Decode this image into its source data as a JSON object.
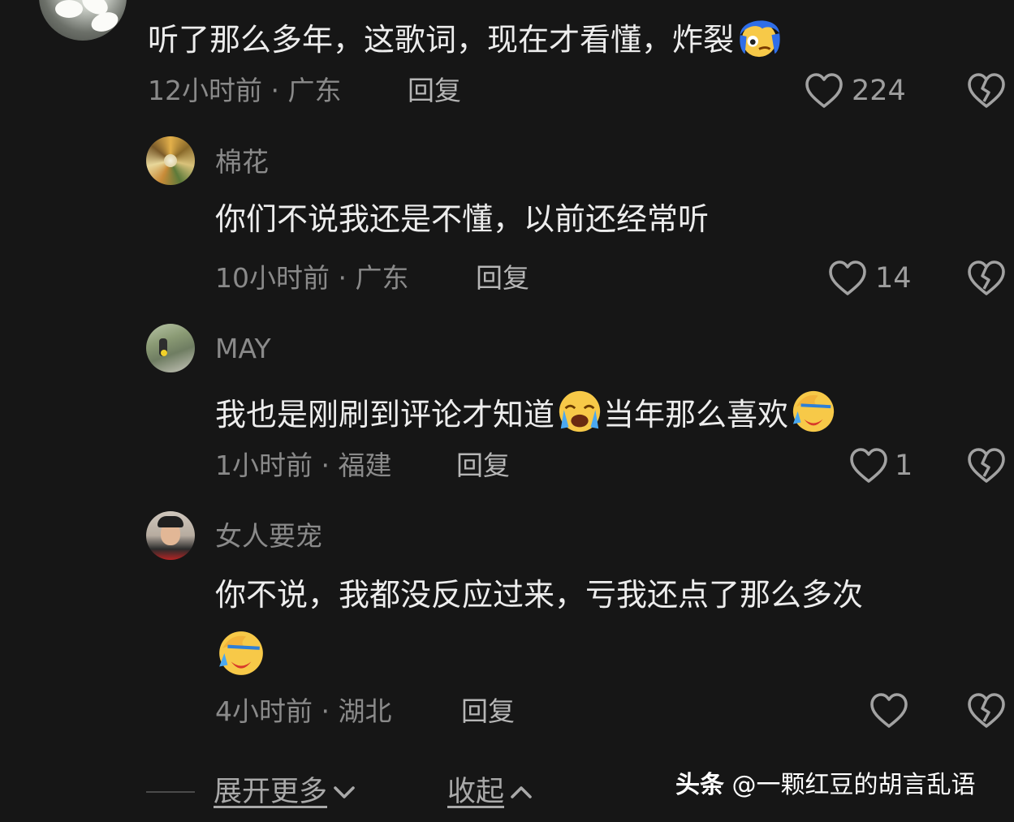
{
  "icons": {
    "like": "heart-outline-icon",
    "dislike": "broken-heart-icon",
    "expand": "chevron-down-icon",
    "collapse": "chevron-up-icon"
  },
  "colors": {
    "background": "#161616",
    "body_text": "#ededed",
    "muted_text": "#8a8a8a"
  },
  "main_comment": {
    "text": "听了那么多年，这歌词，现在才看懂，炸裂",
    "emoji": "blue-hair-face-emoji",
    "meta": "12小时前 · 广东",
    "reply_label": "回复",
    "likes": "224"
  },
  "replies": [
    {
      "username": "棉花",
      "text": "你们不说我还是不懂，以前还经常听",
      "meta": "10小时前 · 广东",
      "reply_label": "回复",
      "likes": "14"
    },
    {
      "username": "MAY",
      "text_part1": "我也是刚刷到评论才知道",
      "text_part2": "当年那么喜欢",
      "emoji1": "loudly-crying-face-emoji",
      "emoji2": "face-palm-crying-emoji",
      "meta": "1小时前 · 福建",
      "reply_label": "回复",
      "likes": "1"
    },
    {
      "username": "女人要宠",
      "text_line1": "你不说，我都没反应过来，亏我还点了那么多次",
      "emoji": "face-palm-crying-emoji",
      "meta": "4小时前 · 湖北",
      "reply_label": "回复",
      "likes": ""
    }
  ],
  "footer": {
    "expand_label": "展开更多",
    "collapse_label": "收起",
    "watermark_brand": "头条",
    "watermark_handle": "@一颗红豆的胡言乱语"
  }
}
